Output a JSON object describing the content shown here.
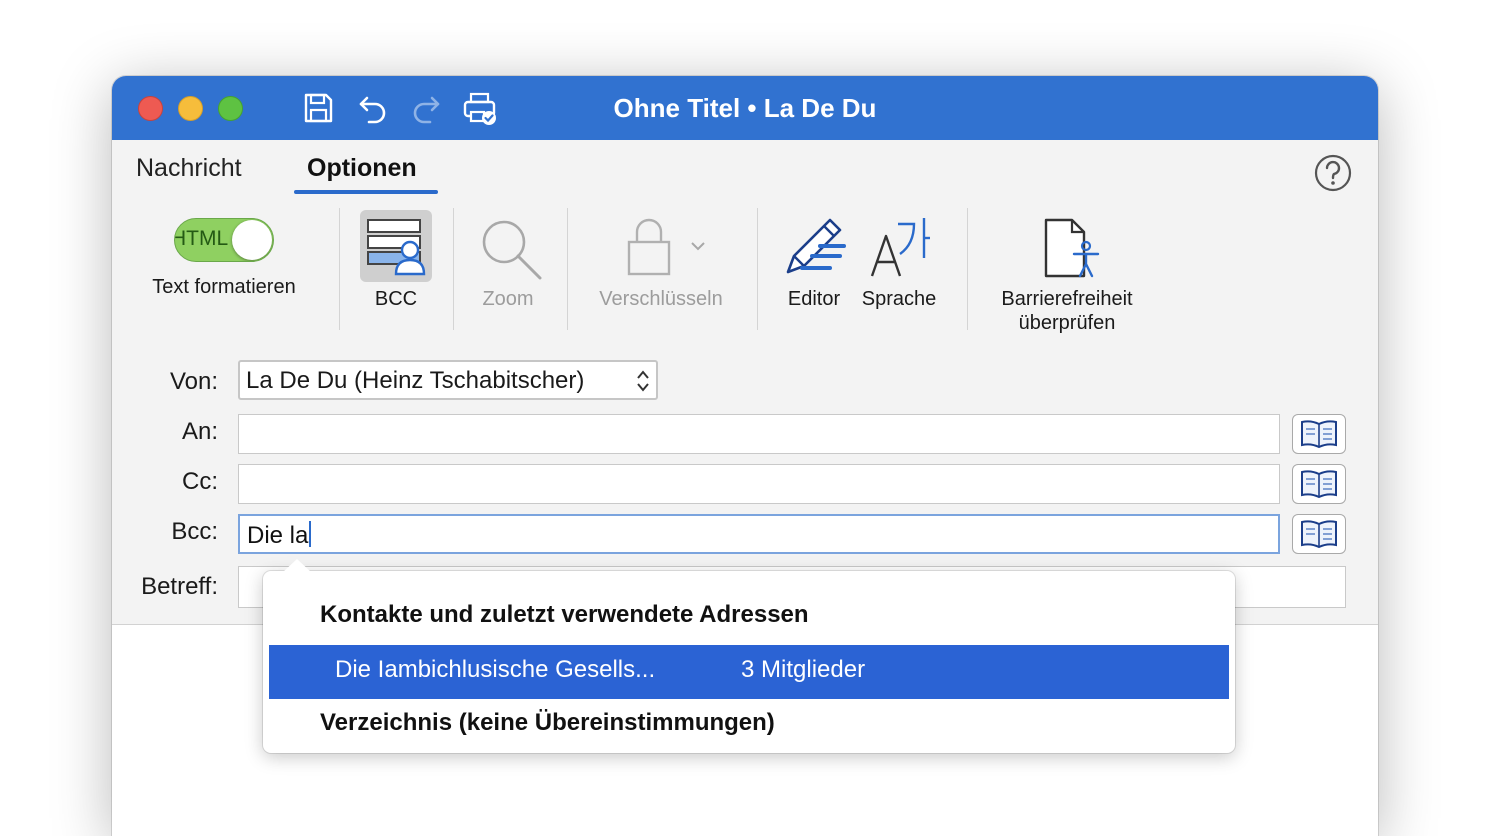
{
  "window": {
    "title": "Ohne Titel • La De Du",
    "title_bar_color": "#3172d0"
  },
  "titlebar_icons": [
    "save-icon",
    "undo-icon",
    "redo-icon",
    "print-icon"
  ],
  "ribbon": {
    "tabs": [
      {
        "label": "Nachricht",
        "selected": false
      },
      {
        "label": "Optionen",
        "selected": true
      }
    ],
    "accent": "#2a6acb",
    "format_toggle": {
      "text": "HTML",
      "label": "Text formatieren",
      "on": true
    },
    "buttons": {
      "bcc": "BCC",
      "zoom": "Zoom",
      "encrypt": "Verschlüsseln",
      "editor": "Editor",
      "language": "Sprache",
      "accessibility_line1": "Barrierefreiheit",
      "accessibility_line2": "überprüfen"
    }
  },
  "form": {
    "from_label": "Von:",
    "from_value": "La De Du (Heinz Tschabitscher)",
    "to_label": "An:",
    "cc_label": "Cc:",
    "bcc_label": "Bcc:",
    "bcc_value": "Die la",
    "subject_label": "Betreff:"
  },
  "autocomplete": {
    "heading": "Kontakte und zuletzt verwendete Adressen",
    "items": [
      {
        "name": "Die Iambichlusische Gesells...",
        "members": "3 Mitglieder",
        "selected": true
      }
    ],
    "directory": "Verzeichnis (keine Übereinstimmungen)",
    "highlight_color": "#2b63d4"
  }
}
